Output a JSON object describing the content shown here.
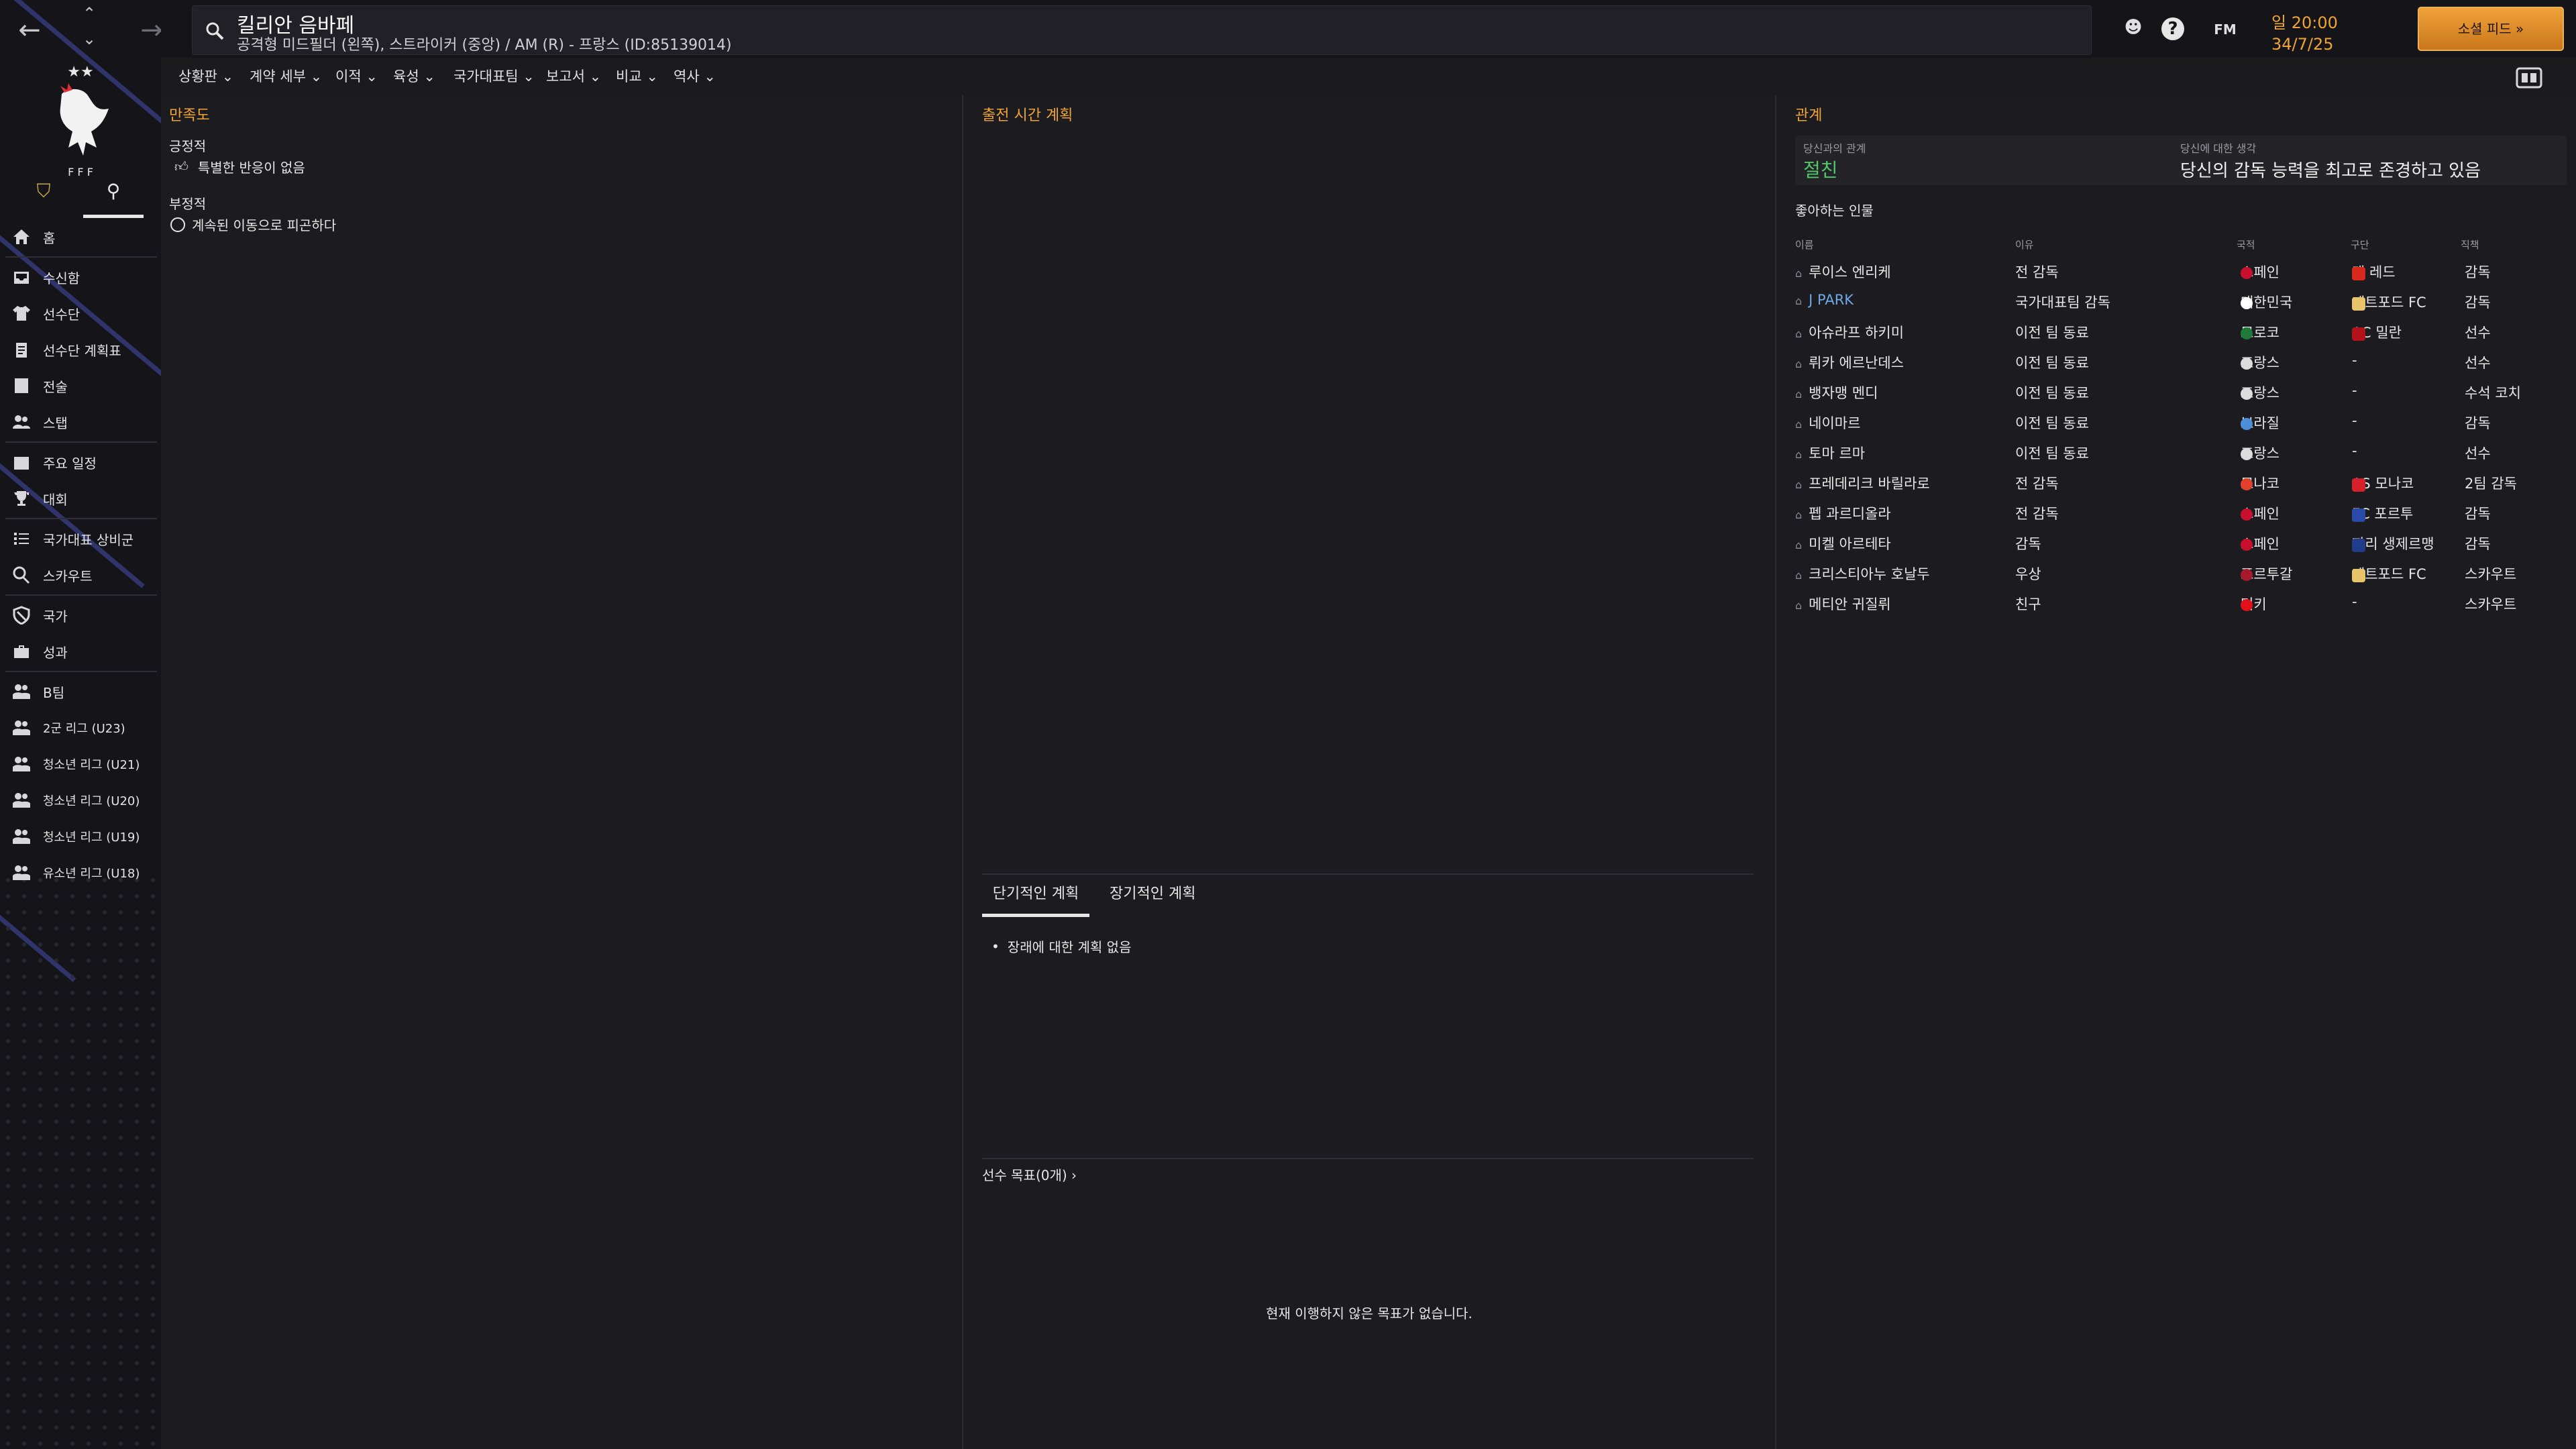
{
  "topbar": {
    "player_name": "킬리안 음바페",
    "player_desc": "공격형 미드필더 (왼쪽), 스트라이커 (중앙) / AM (R) - 프랑스 (ID:85139014)",
    "fm_label": "FM",
    "clock_time": "일 20:00",
    "clock_date": "34/7/25",
    "social_label": "소셜 피드",
    "help_label": "?"
  },
  "sidebar": {
    "items": [
      {
        "label": "홈",
        "icon": "home-icon"
      },
      {
        "label": "수신함",
        "icon": "inbox-icon"
      },
      {
        "label": "선수단",
        "icon": "shirt-icon"
      },
      {
        "label": "선수단 계획표",
        "icon": "clipboard-icon"
      },
      {
        "label": "전술",
        "icon": "tactics-icon"
      },
      {
        "label": "스탭",
        "icon": "staff-icon"
      },
      {
        "label": "주요 일정",
        "icon": "calendar-icon"
      },
      {
        "label": "대회",
        "icon": "trophy-icon"
      },
      {
        "label": "국가대표 상비군",
        "icon": "list-icon"
      },
      {
        "label": "스카우트",
        "icon": "search-icon"
      },
      {
        "label": "국가",
        "icon": "shield-icon"
      },
      {
        "label": "성과",
        "icon": "briefcase-icon"
      },
      {
        "label": "B팀",
        "icon": "team-icon"
      },
      {
        "label": "2군 리그 (U23)",
        "icon": "team-icon"
      },
      {
        "label": "청소년 리그 (U21)",
        "icon": "team-icon"
      },
      {
        "label": "청소년 리그 (U20)",
        "icon": "team-icon"
      },
      {
        "label": "청소년 리그 (U19)",
        "icon": "team-icon"
      },
      {
        "label": "유소년 리그 (U18)",
        "icon": "team-icon"
      }
    ]
  },
  "subtabs": [
    {
      "label": "상황판"
    },
    {
      "label": "계약 세부"
    },
    {
      "label": "이적"
    },
    {
      "label": "육성"
    },
    {
      "label": "국가대표팀"
    },
    {
      "label": "보고서"
    },
    {
      "label": "비교"
    },
    {
      "label": "역사"
    }
  ],
  "satisfaction": {
    "title": "만족도",
    "positive_label": "긍정적",
    "positive_text": "특별한 반응이 없음",
    "negative_label": "부정적",
    "negative_text": "계속된 이동으로 피곤하다"
  },
  "playtime": {
    "title": "출전 시간 계획",
    "tab_short": "단기적인 계획",
    "tab_long": "장기적인 계획",
    "no_plan": "장래에 대한 계획 없음",
    "goals_label": "선수 목표(0개) ›",
    "goals_empty": "현재 이행하지 않은 목표가 없습니다."
  },
  "relations": {
    "title": "관계",
    "with_you_label": "당신과의 관계",
    "with_you_value": "절친",
    "opinion_label": "당신에 대한 생각",
    "opinion_value": "당신의 감독 능력을 최고로 존경하고 있음",
    "favored_title": "좋아하는 인물",
    "columns": [
      "이름",
      "이유",
      "국적",
      "구단",
      "직책"
    ],
    "people": [
      {
        "name": "루이스 엔리케",
        "reason": "전 감독",
        "nation": "스페인",
        "nation_color": "#c8102e",
        "club": "맨 레드",
        "club_color": "#da291c",
        "role": "감독"
      },
      {
        "name": "J PARK",
        "reason": "국가대표팀 감독",
        "nation": "대한민국",
        "nation_color": "#ffffff",
        "club": "데트포드 FC",
        "club_color": "#e8c46a",
        "role": "감독",
        "highlight": true
      },
      {
        "name": "아슈라프 하키미",
        "reason": "이전 팀 동료",
        "nation": "모로코",
        "nation_color": "#1f7a3a",
        "club": "AC 밀란",
        "club_color": "#b3121b",
        "role": "선수"
      },
      {
        "name": "뤼카 에르난데스",
        "reason": "이전 팀 동료",
        "nation": "프랑스",
        "nation_color": "#dcdcdc",
        "club": "-",
        "club_color": "",
        "role": "선수"
      },
      {
        "name": "뱅자맹 멘디",
        "reason": "이전 팀 동료",
        "nation": "프랑스",
        "nation_color": "#dcdcdc",
        "club": "-",
        "club_color": "",
        "role": "수석 코치"
      },
      {
        "name": "네이마르",
        "reason": "이전 팀 동료",
        "nation": "브라질",
        "nation_color": "#4a8fd8",
        "club": "-",
        "club_color": "",
        "role": "감독"
      },
      {
        "name": "토마 르마",
        "reason": "이전 팀 동료",
        "nation": "프랑스",
        "nation_color": "#dcdcdc",
        "club": "-",
        "club_color": "",
        "role": "선수"
      },
      {
        "name": "프레데리크 바릴라로",
        "reason": "전 감독",
        "nation": "모나코",
        "nation_color": "#e2402a",
        "club": "AS 모나코",
        "club_color": "#d6202a",
        "role": "2팀 감독"
      },
      {
        "name": "펩 과르디올라",
        "reason": "전 감독",
        "nation": "스페인",
        "nation_color": "#c8102e",
        "club": "FC 포르투",
        "club_color": "#2a4aa8",
        "role": "감독"
      },
      {
        "name": "미켈 아르테타",
        "reason": "감독",
        "nation": "스페인",
        "nation_color": "#c8102e",
        "club": "파리 생제르맹",
        "club_color": "#1f3d8a",
        "role": "감독"
      },
      {
        "name": "크리스티아누 호날두",
        "reason": "우상",
        "nation": "포르투갈",
        "nation_color": "#a8192e",
        "club": "데트포드 FC",
        "club_color": "#e8c46a",
        "role": "스카우트"
      },
      {
        "name": "메티안 귀질뤼",
        "reason": "친구",
        "nation": "터키",
        "nation_color": "#e3101a",
        "club": "-",
        "club_color": "",
        "role": "스카우트"
      }
    ]
  },
  "colors": {
    "accent": "#f0a532",
    "positive": "#4fc86a",
    "negative": "#e2403a",
    "bg": "#1b1b1e",
    "sidebar": "#141419"
  }
}
